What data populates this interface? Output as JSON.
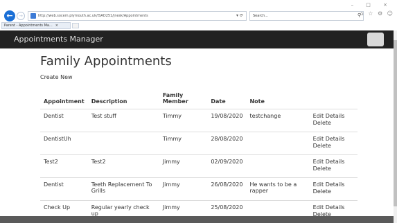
{
  "browser": {
    "url": "http://web.socem.plymouth.ac.uk/ISAD251/jnesk/Appointments",
    "addr_actions": "▾ ⟳",
    "search_placeholder": "Search...",
    "tab_label": "Parent - Appointments Ma...",
    "tab_close": "×",
    "window_controls": "– □ ×",
    "tool_icons": "⌂ ☆ ⚙ ☺"
  },
  "navbar": {
    "brand": "Appointments Manager"
  },
  "page": {
    "title": "Family Appointments",
    "create_new": "Create New"
  },
  "table": {
    "headers": [
      "Appointment",
      "Description",
      "Family Member",
      "Date",
      "Note",
      ""
    ],
    "edit_label": "Edit Details",
    "delete_label": "Delete",
    "rows": [
      {
        "appointment": "Dentist",
        "description": "Test stuff",
        "member": "Timmy",
        "date": "19/08/2020",
        "note": "testchange"
      },
      {
        "appointment": "DentistUh",
        "description": "",
        "member": "Timmy",
        "date": "28/08/2020",
        "note": ""
      },
      {
        "appointment": "Test2",
        "description": "Test2",
        "member": "Jimmy",
        "date": "02/09/2020",
        "note": ""
      },
      {
        "appointment": "Dentist",
        "description": "Teeth Replacement To Grills",
        "member": "Jimmy",
        "date": "26/08/2020",
        "note": "He wants to be a rapper"
      },
      {
        "appointment": "Check Up",
        "description": "Regular yearly check up",
        "member": "Jimmy",
        "date": "25/08/2020",
        "note": ""
      }
    ]
  },
  "colors": {
    "navbar_bg": "#222222",
    "accent_blue": "#1a6fd6"
  }
}
